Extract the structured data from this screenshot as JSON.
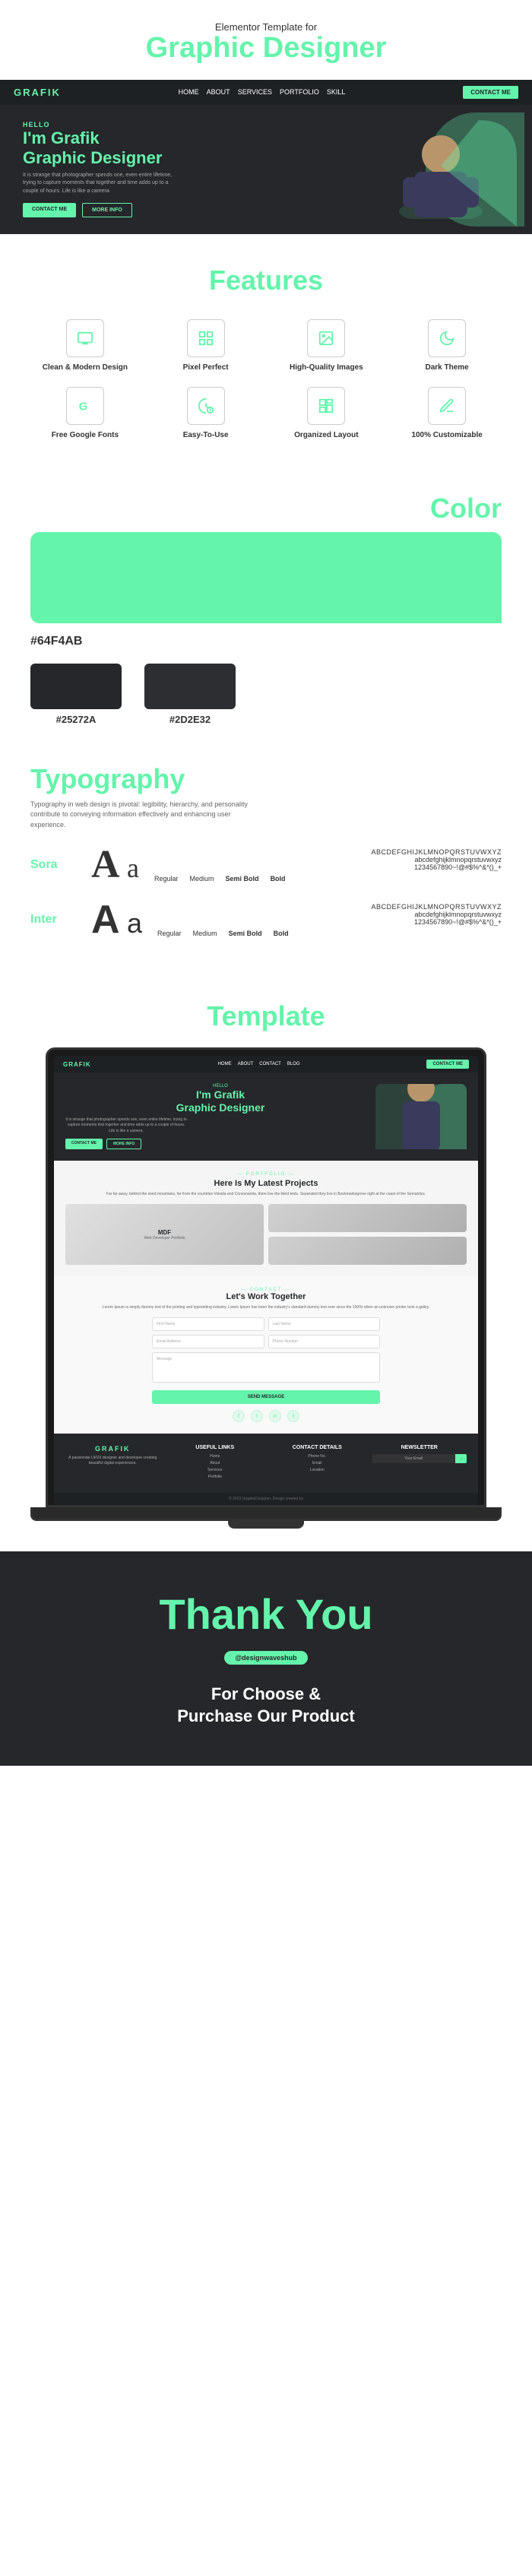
{
  "header": {
    "subtitle": "Elementor Template for",
    "title": "Graphic Designer"
  },
  "hero": {
    "hello": "HELLO",
    "name_line1": "I'm Grafik",
    "name_line2_plain": "",
    "name_line2_colored": "Graphic Designer",
    "description": "It is strange that photographer spends one, even entire lifetime, trying to capture moments that together and time adds up to a couple of hours. Life is like a camera.",
    "btn_contact": "CONTACT ME",
    "btn_more": "MORE INFO"
  },
  "nav": {
    "logo": "GRAFIK",
    "links": [
      "HOME",
      "ABOUT",
      "SERVICES",
      "PORTFOLIO",
      "SKILL"
    ],
    "contact_btn": "CONTACT ME"
  },
  "features": {
    "title": "Features",
    "items": [
      {
        "icon": "monitor",
        "label": "Clean & Modern Design"
      },
      {
        "icon": "pixel",
        "label": "Pixel Perfect"
      },
      {
        "icon": "image",
        "label": "High-Quality Images"
      },
      {
        "icon": "moon",
        "label": "Dark Theme"
      },
      {
        "icon": "font",
        "label": "Free Google Fonts"
      },
      {
        "icon": "touch",
        "label": "Easy-To-Use"
      },
      {
        "icon": "layout",
        "label": "Organized Layout"
      },
      {
        "icon": "custom",
        "label": "100% Customizable"
      }
    ]
  },
  "colors": {
    "section_title": "Color",
    "main_color": "#64F4AB",
    "main_hex_label": "#64F4AB",
    "dark_colors": [
      {
        "hex": "#25272A",
        "label": "#25272A"
      },
      {
        "hex": "#2D2E32",
        "label": "#2D2E32"
      }
    ]
  },
  "typography": {
    "title": "Typography",
    "description": "Typography in web design is pivotal: legibility, hierarchy, and personality contribute to conveying information effectively and enhancing user experience.",
    "fonts": [
      {
        "name": "Sora",
        "chars_upper": "ABCDEFGHIJKLMNOPQRSTUVWXYZ",
        "chars_lower": "abcdefghijklmnopqrstuvwxyz",
        "chars_nums": "1234567890~!@#$%^&*()_+",
        "weights": [
          "Regular",
          "Medium",
          "Semi Bold",
          "Bold"
        ]
      },
      {
        "name": "Inter",
        "chars_upper": "ABCDEFGHIJKLMNOPQRSTUVWXYZ",
        "chars_lower": "abcdefghijklmnopqrstuvwxyz",
        "chars_nums": "1234567890~!@#$%^&*()_+",
        "weights": [
          "Regular",
          "Medium",
          "Semi Bold",
          "Bold"
        ]
      }
    ]
  },
  "template_section": {
    "title": "Template"
  },
  "mini_nav": {
    "logo": "GRAFIK",
    "links": [
      "HOME",
      "ABOUT",
      "CONTACT",
      "BLOG"
    ],
    "contact_btn": "CONTACT ME"
  },
  "mini_hero": {
    "hello": "HELLO",
    "name_line1": "I'm Grafik",
    "name_line2": "Graphic Designer",
    "description": "It is strange that photographer spends one, even entire lifetime, trying to capture moments that together and time adds up to a couple of hours. Life is like a camera.",
    "btn_contact": "CONTACT ME",
    "btn_more": "MORE INFO"
  },
  "mini_portfolio": {
    "label": "— PORTFOLIO —",
    "title": "Here Is My Latest Projects",
    "description": "Far far away, behind the word mountains, far from the countries Vokalia and Consonantia, there live the blind texts. Separated they live in Bookmarksgrove right at the coast of the Semantics.",
    "main_project": {
      "title": "MDF",
      "subtitle": "Web Developer Portfolio"
    }
  },
  "mini_contact": {
    "label": "— CONTACT —",
    "title": "Let's Work Together",
    "description": "Lorem Ipsum is simply dummy text of the printing and typesetting industry. Lorem Ipsum has been the industry's standard dummy text ever since the 1500s when an unknown printer took a galley.",
    "fields": [
      "First Name",
      "Last Name",
      "Email Address",
      "Phone Number",
      "Message"
    ],
    "submit_btn": "SEND MESSAGE"
  },
  "mini_footer": {
    "logo": "GRAFIK",
    "tagline": "A passionate UI/UX designer and developer creating beautiful digital experiences.",
    "useful_links_title": "USEFUL LINKS",
    "useful_links": [
      "Home",
      "About",
      "Services",
      "Portfolio"
    ],
    "contact_title": "CONTACT DETAILS",
    "contact_items": [
      "Phone No.",
      "Email",
      "Location"
    ],
    "newsletter_title": "NEWSLETTER",
    "newsletter_placeholder": "Your Email",
    "newsletter_btn": "→",
    "copyright": "© 2023 GraphicDesigner. Design created by"
  },
  "thankyou": {
    "title": "Thank You",
    "badge": "@designwaveshub",
    "subtitle_line1": "For Choose &",
    "subtitle_line2": "Purchase Our Product"
  }
}
